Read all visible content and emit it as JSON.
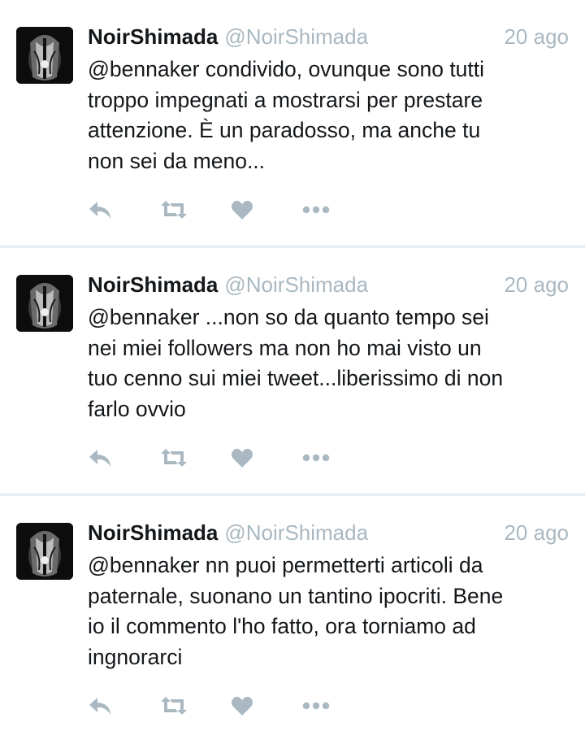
{
  "feed": {
    "tweets": [
      {
        "author": {
          "name": "NoirShimada",
          "handle": "@NoirShimada",
          "avatar": "avatar-image"
        },
        "time": "20 ago",
        "text": "@bennaker condivido, ovunque sono tutti\ntroppo impegnati a mostrarsi per prestare\nattenzione. È un paradosso, ma anche tu\nnon sei da meno..."
      },
      {
        "author": {
          "name": "NoirShimada",
          "handle": "@NoirShimada",
          "avatar": "avatar-image"
        },
        "time": "20 ago",
        "text": "@bennaker ...non so da quanto tempo sei\nnei miei followers ma non ho mai visto un\ntuo cenno sui miei tweet...liberissimo di non\nfarlo ovvio"
      },
      {
        "author": {
          "name": "NoirShimada",
          "handle": "@NoirShimada",
          "avatar": "avatar-image"
        },
        "time": "20 ago",
        "text": "@bennaker nn puoi permetterti articoli da\npaternale, suonano un tantino ipocriti. Bene\nio il commento l'ho fatto, ora torniamo ad\ningnorarci"
      }
    ]
  },
  "actions": [
    {
      "name": "reply",
      "icon": "reply-icon"
    },
    {
      "name": "retweet",
      "icon": "retweet-icon"
    },
    {
      "name": "like",
      "icon": "heart-icon"
    },
    {
      "name": "more",
      "icon": "more-icon"
    }
  ],
  "colors": {
    "background": "#e6ecf0",
    "card": "#ffffff",
    "text": "#14171a",
    "muted": "#aab8c2",
    "icon": "#aab8c2"
  }
}
